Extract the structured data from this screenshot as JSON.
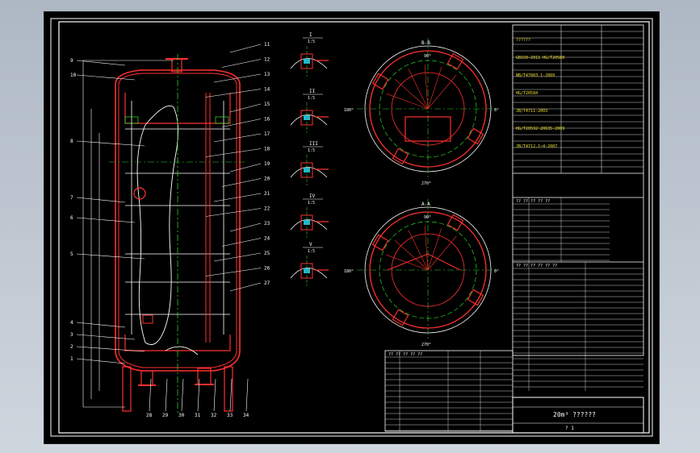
{
  "drawing": {
    "title_main": "20m³ ??????",
    "sheet_no": "? 1",
    "callouts_left": [
      "9",
      "10",
      "8",
      "7",
      "6",
      "5",
      "4",
      "3",
      "2",
      "1"
    ],
    "callouts_right": [
      "11",
      "12",
      "13",
      "14",
      "15",
      "16",
      "17",
      "18",
      "19",
      "20",
      "21",
      "22",
      "23",
      "24",
      "25",
      "26",
      "27"
    ],
    "callouts_bottom": [
      "28",
      "29",
      "30",
      "31",
      "32",
      "33",
      "34"
    ],
    "detail_labels": [
      "I",
      "II",
      "III",
      "IV",
      "V"
    ],
    "detail_scales": [
      "1:5",
      "1:5",
      "1:5",
      "1:5",
      "1:5"
    ],
    "section_labels": [
      "B-B",
      "A-A"
    ],
    "angle_labels": [
      "0°",
      "90°",
      "180°",
      "270°"
    ],
    "spec_lines": [
      "??????",
      "GB150-2011   HG/T20580",
      "NB/T47003.1-2009",
      "HG/T20584",
      "JB/T4711-2003",
      "HG/T20592~20635-2009",
      "JB/T4712.1~4-2007"
    ],
    "spec_table_header": "?? ?? ?? ?? ??",
    "nozzle_header": "?? ?? ?? ?? ??",
    "parts_header": "?? ?? ?? ?? ?? ??"
  }
}
